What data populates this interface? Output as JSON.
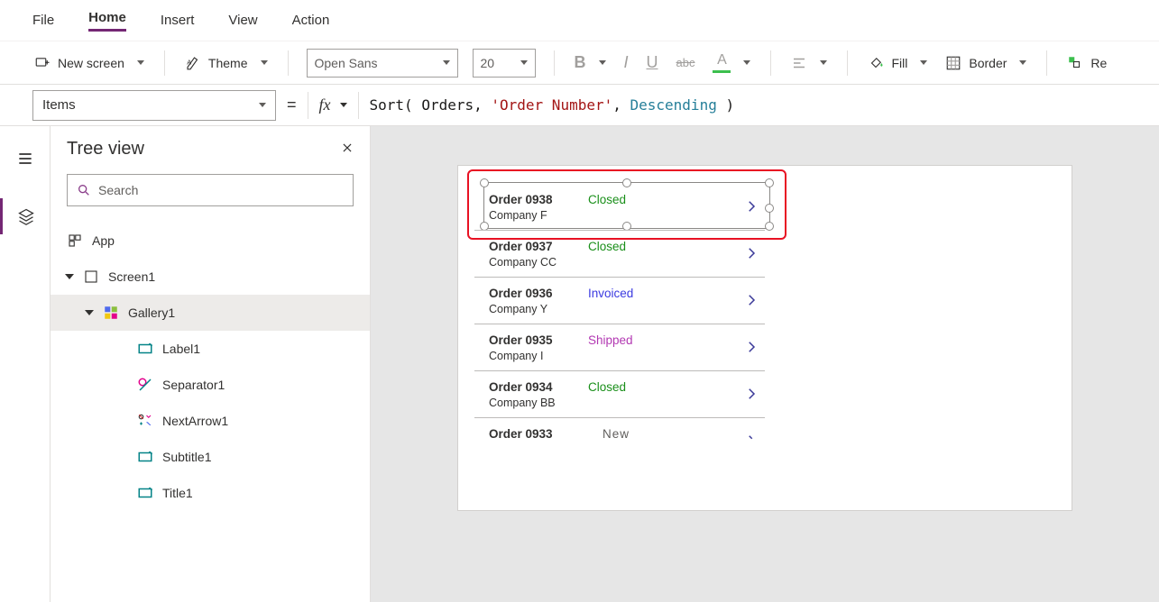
{
  "menu": {
    "items": [
      "File",
      "Home",
      "Insert",
      "View",
      "Action"
    ],
    "active": "Home"
  },
  "toolbar": {
    "newScreen": "New screen",
    "theme": "Theme",
    "fontFamily": "Open Sans",
    "fontSize": "20",
    "fill": "Fill",
    "border": "Border",
    "reorder_prefix": "Re"
  },
  "formula": {
    "property": "Items",
    "tokens": {
      "fn": "Sort",
      "open": "( ",
      "arg1": "Orders",
      "comma1": ", ",
      "arg2": "'Order Number'",
      "comma2": ", ",
      "arg3": "Descending",
      "close": " )"
    }
  },
  "treeview": {
    "title": "Tree view",
    "searchPlaceholder": "Search",
    "nodes": {
      "app": "App",
      "screen1": "Screen1",
      "gallery1": "Gallery1",
      "label1": "Label1",
      "separator1": "Separator1",
      "nextArrow1": "NextArrow1",
      "subtitle1": "Subtitle1",
      "title1": "Title1"
    }
  },
  "gallery": {
    "rows": [
      {
        "title": "Order 0938",
        "subtitle": "Company F",
        "status": "Closed",
        "statusClass": "st-closed"
      },
      {
        "title": "Order 0937",
        "subtitle": "Company CC",
        "status": "Closed",
        "statusClass": "st-closed"
      },
      {
        "title": "Order 0936",
        "subtitle": "Company Y",
        "status": "Invoiced",
        "statusClass": "st-invoiced"
      },
      {
        "title": "Order 0935",
        "subtitle": "Company I",
        "status": "Shipped",
        "statusClass": "st-shipped"
      },
      {
        "title": "Order 0934",
        "subtitle": "Company BB",
        "status": "Closed",
        "statusClass": "st-closed"
      },
      {
        "title": "Order 0933",
        "subtitle": "",
        "status": "New",
        "statusClass": "st-new"
      }
    ]
  }
}
